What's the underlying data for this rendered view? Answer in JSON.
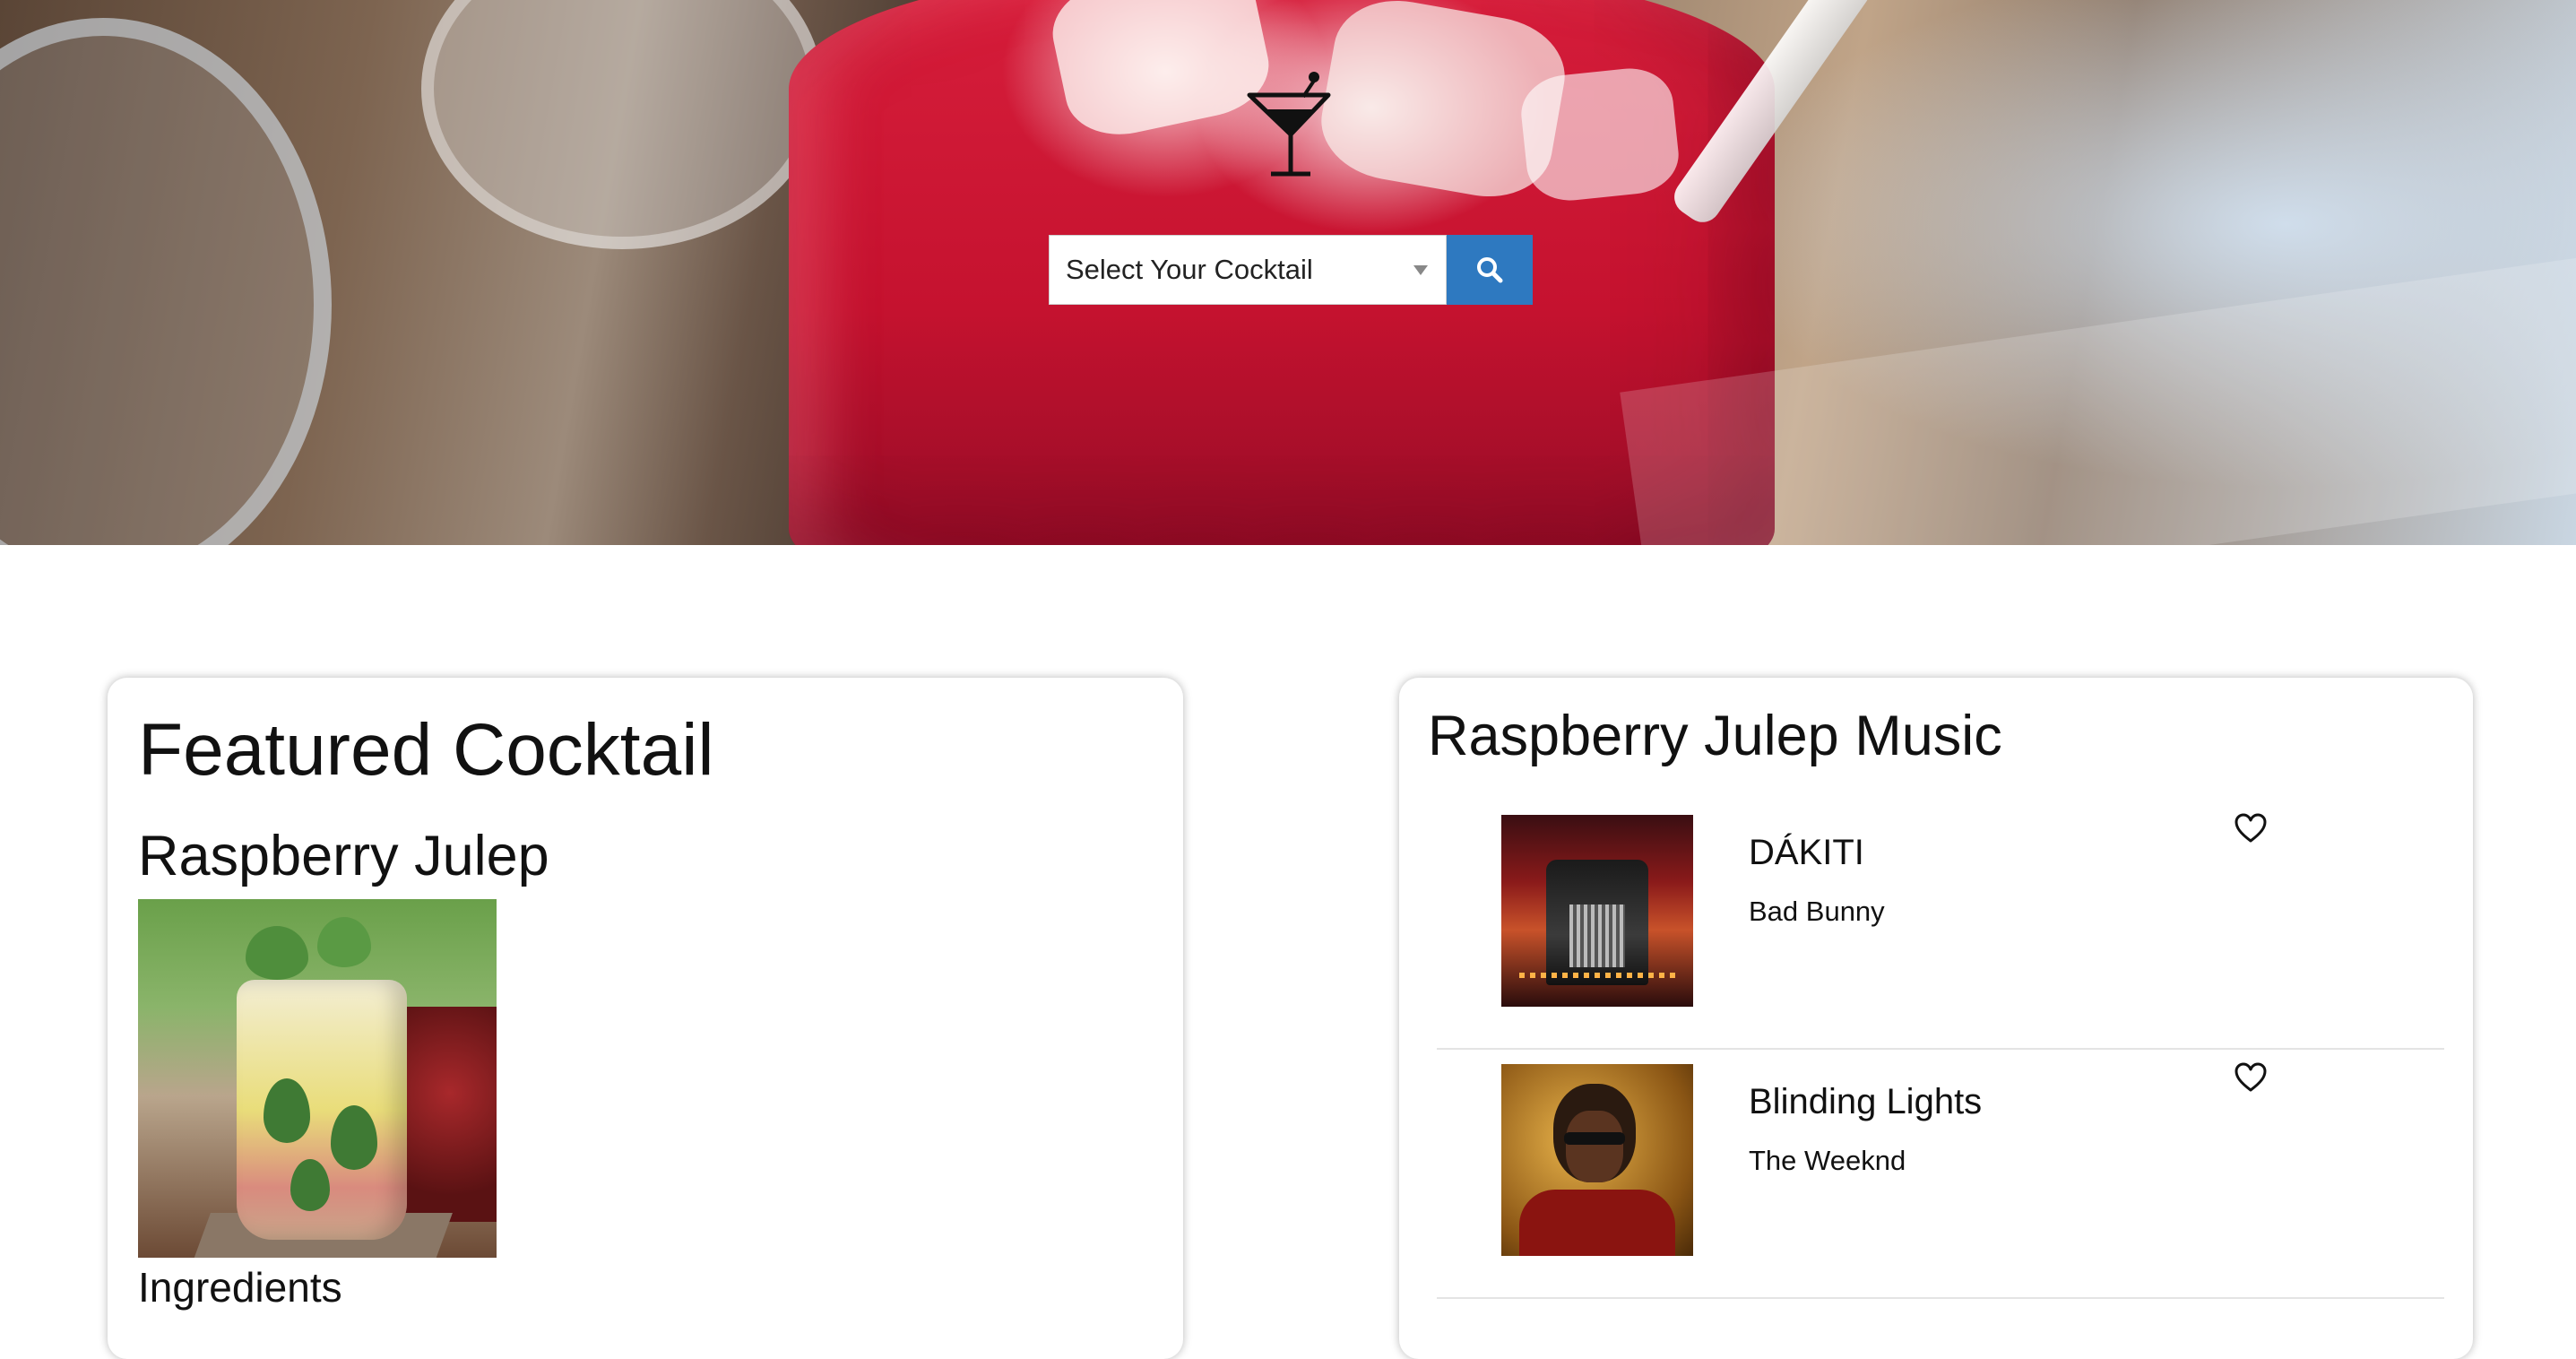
{
  "hero": {
    "logo_icon": "cocktail-glass-icon",
    "search": {
      "select_value": "Select Your Cocktail",
      "button_icon": "search-icon"
    }
  },
  "featured": {
    "heading": "Featured Cocktail",
    "name": "Raspberry Julep",
    "ingredients_label": "Ingredients"
  },
  "music": {
    "heading": "Raspberry Julep Music",
    "tracks": [
      {
        "title": "DÁKITI",
        "artist": "Bad Bunny"
      },
      {
        "title": "Blinding Lights",
        "artist": "The Weeknd"
      }
    ]
  },
  "colors": {
    "search_button": "#2e79c0",
    "card_background": "#ffffff"
  }
}
